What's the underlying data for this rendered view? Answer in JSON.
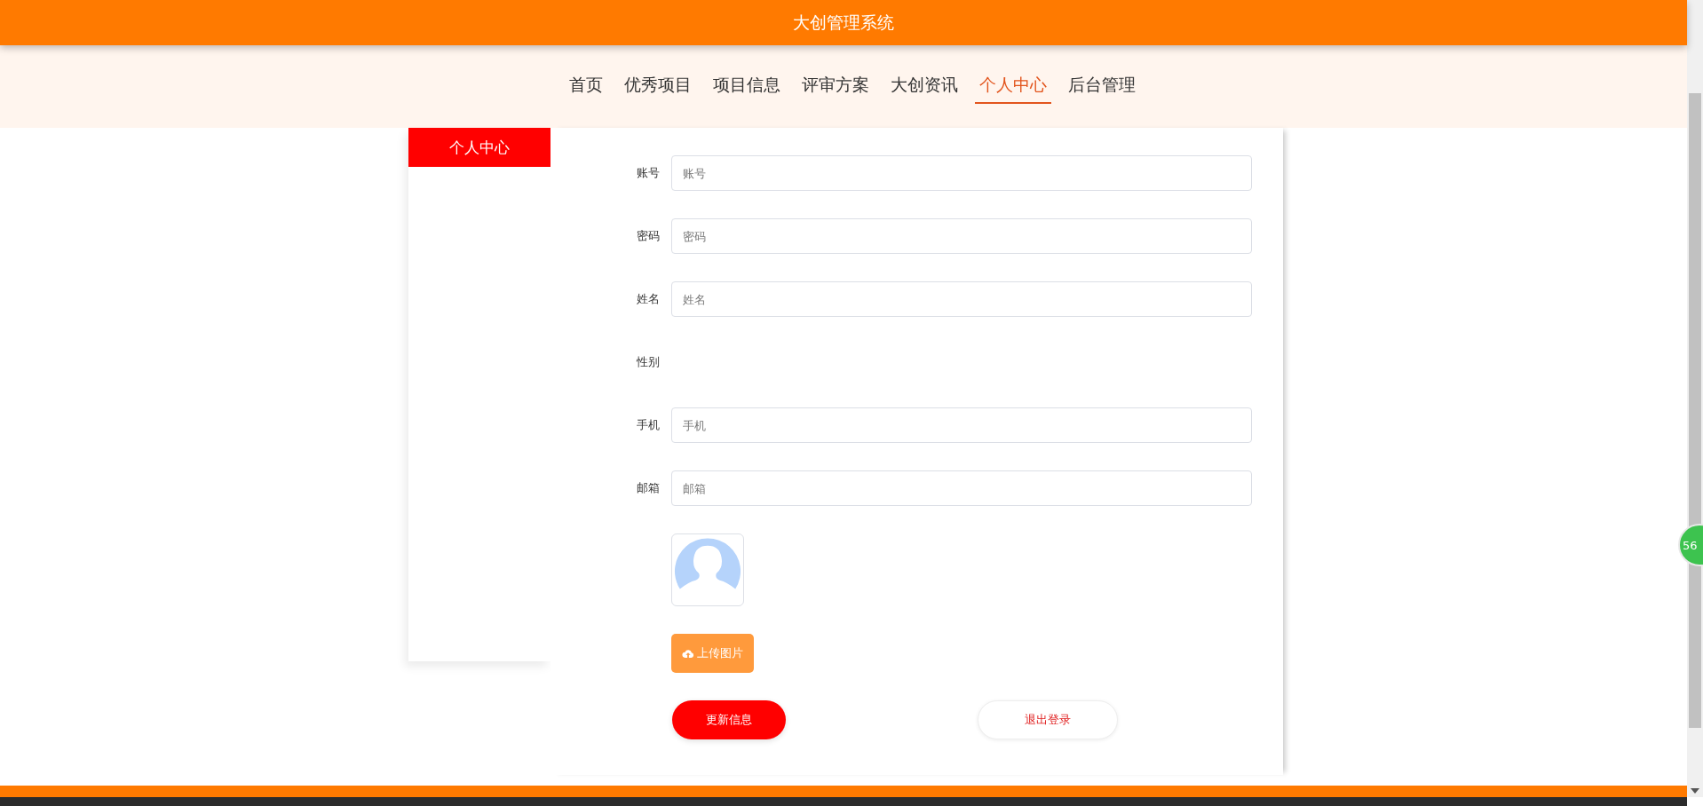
{
  "header": {
    "title": "大创管理系统"
  },
  "nav": [
    {
      "label": "首页",
      "selected": false
    },
    {
      "label": "优秀项目",
      "selected": false
    },
    {
      "label": "项目信息",
      "selected": false
    },
    {
      "label": "评审方案",
      "selected": false
    },
    {
      "label": "大创资讯",
      "selected": false
    },
    {
      "label": "个人中心",
      "selected": true
    },
    {
      "label": "后台管理",
      "selected": false
    }
  ],
  "sidebar": {
    "title": "个人中心"
  },
  "form": {
    "fields": [
      {
        "kind": "input",
        "label": "账号",
        "placeholder": "账号"
      },
      {
        "kind": "input",
        "label": "密码",
        "placeholder": "密码"
      },
      {
        "kind": "input",
        "label": "姓名",
        "placeholder": "姓名"
      },
      {
        "kind": "empty",
        "label": "性别"
      },
      {
        "kind": "input",
        "label": "手机",
        "placeholder": "手机"
      },
      {
        "kind": "input",
        "label": "邮箱",
        "placeholder": "邮箱"
      }
    ],
    "upload_button": "上传图片",
    "buttons": [
      {
        "kind": "primary",
        "label": "更新信息"
      },
      {
        "kind": "outline",
        "label": "退出登录"
      }
    ]
  },
  "floating_badge": "56"
}
